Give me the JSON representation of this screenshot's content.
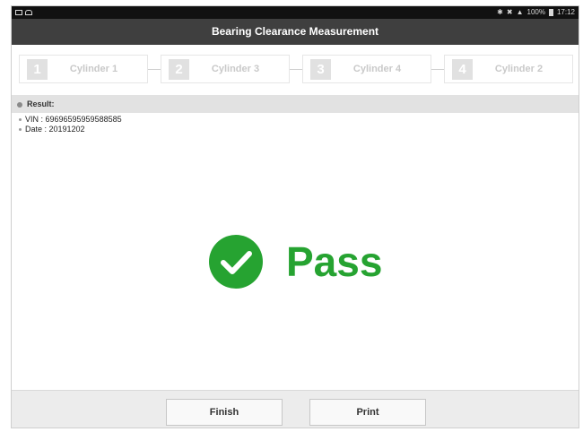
{
  "status_bar": {
    "left_icons": [
      "image-icon",
      "android-icon"
    ],
    "bluetooth_icon": "bluetooth-icon",
    "mute_icon": "mute-icon",
    "wifi_icon": "wifi-icon",
    "battery_text": "100%",
    "battery_icon": "battery-icon",
    "time": "17:12"
  },
  "title": "Bearing Clearance Measurement",
  "steps": [
    {
      "number": "1",
      "label": "Cylinder 1"
    },
    {
      "number": "2",
      "label": "Cylinder 3"
    },
    {
      "number": "3",
      "label": "Cylinder 4"
    },
    {
      "number": "4",
      "label": "Cylinder 2"
    }
  ],
  "result": {
    "heading": "Result:",
    "vin": "VIN : 69696595959588585",
    "date": "Date : 20191202",
    "status": "Pass",
    "status_color": "#26a331"
  },
  "buttons": {
    "finish": "Finish",
    "print": "Print"
  }
}
